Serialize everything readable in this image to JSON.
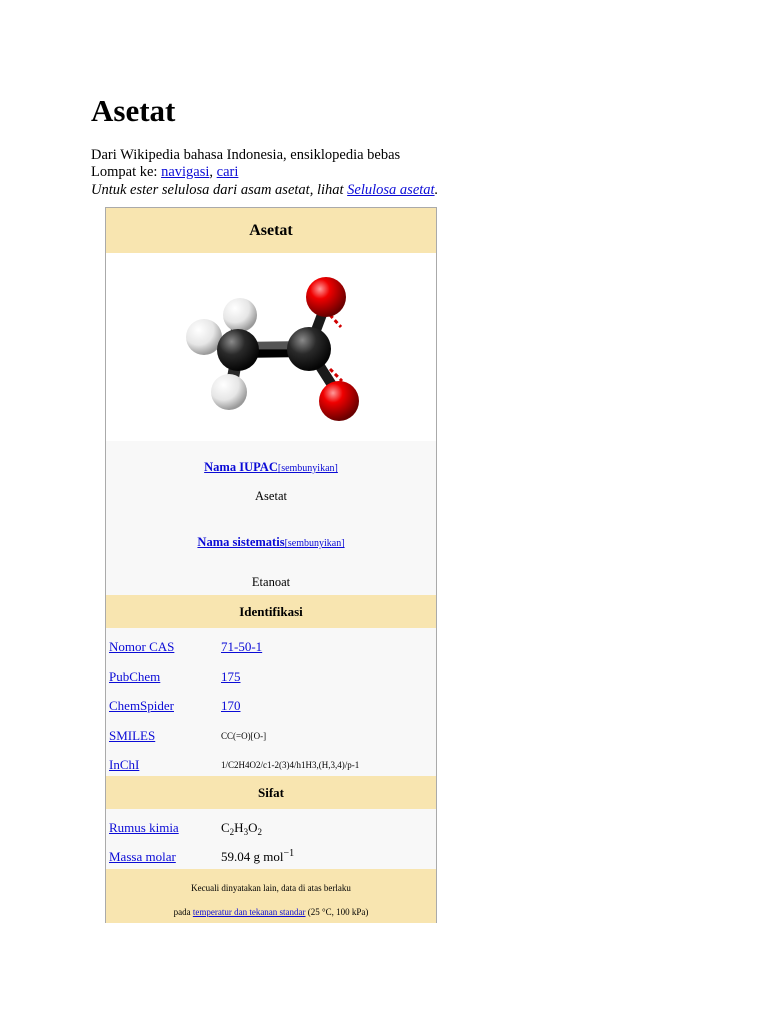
{
  "page": {
    "title": "Asetat",
    "tagline": "Dari Wikipedia bahasa Indonesia, ensiklopedia bebas",
    "jump_label": "Lompat ke: ",
    "jump_nav": "navigasi",
    "jump_sep": ", ",
    "jump_search": "cari",
    "hatnote_text": "Untuk ester selulosa dari asam asetat, lihat ",
    "hatnote_link": "Selulosa asetat",
    "hatnote_end": "."
  },
  "infobox": {
    "title": "Asetat",
    "image_icon": "ball-and-stick-molecule",
    "iupac_label": "Nama IUPAC",
    "iupac_toggle": "[sembunyikan]",
    "iupac_value": "Asetat",
    "systematic_label": "Nama sistematis",
    "systematic_toggle": "[sembunyikan]",
    "systematic_value": "Etanoat",
    "ident_header": "Identifikasi",
    "ident_rows": [
      {
        "label": "Nomor CAS",
        "value": "71-50-1"
      },
      {
        "label": "PubChem",
        "value": "175"
      },
      {
        "label": "ChemSpider",
        "value": "170"
      },
      {
        "label": "SMILES",
        "value": "CC(=O)[O-]"
      },
      {
        "label": "InChI",
        "value": "1/C2H4O2/c1-2(3)4/h1H3,(H,3,4)/p-1"
      }
    ],
    "sifat_header": "Sifat",
    "formula_label": "Rumus kimia",
    "formula_parts": [
      "C",
      "2",
      "H",
      "3",
      "O",
      "2"
    ],
    "molar_label": "Massa molar",
    "molar_value": "59.04 g mol",
    "molar_exp": "−1",
    "footer_line1": "Kecuali dinyatakan lain, data di atas berlaku",
    "footer_pre": "pada ",
    "footer_link": "temperatur dan tekanan standar",
    "footer_post": " (25 °C, 100 kPa)"
  },
  "colors": {
    "band": "#f8e5b0",
    "link": "#0b0bd6",
    "border": "#aaaaaa",
    "carbon": "#1a1a1a",
    "oxygen": "#e00000",
    "hydrogen": "#f0f0f0"
  }
}
